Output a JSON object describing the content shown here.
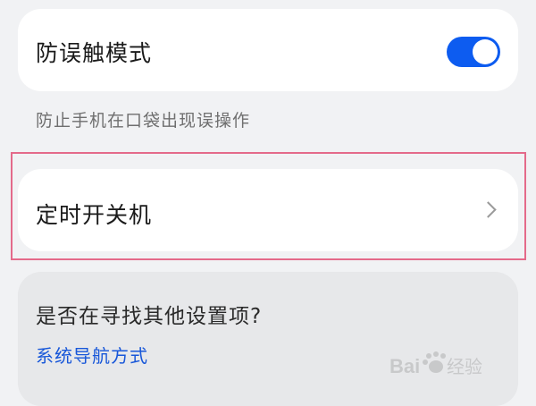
{
  "settings": {
    "pocket_mode": {
      "label": "防误触模式",
      "enabled": true,
      "description": "防止手机在口袋出现误操作"
    },
    "scheduled_power": {
      "label": "定时开关机"
    }
  },
  "suggestion": {
    "question": "是否在寻找其他设置项?",
    "link_label": "系统导航方式"
  },
  "watermark": {
    "text": "Baidu 经验"
  },
  "colors": {
    "accent": "#0d5cf0",
    "link": "#1857d9",
    "highlight_border": "#e46a8a",
    "background": "#f1f2f4"
  },
  "icons": {
    "toggle": "toggle-switch-on",
    "chevron": "chevron-right-icon"
  }
}
